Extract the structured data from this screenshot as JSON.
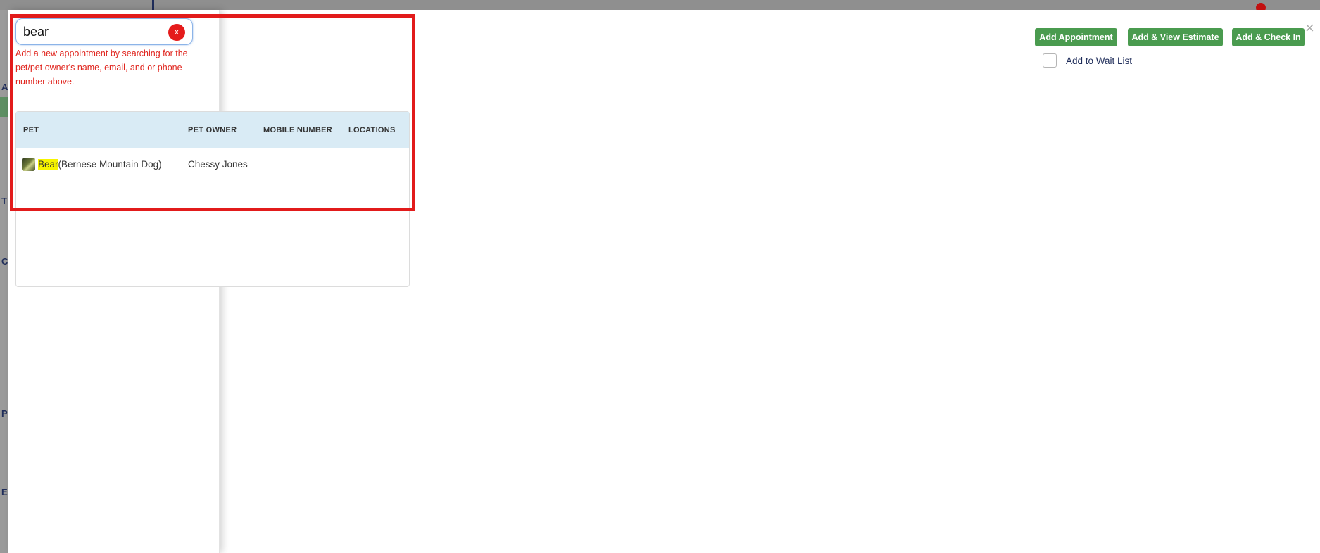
{
  "background": {
    "side_letters": [
      "A",
      "T",
      "C",
      "P",
      "E"
    ]
  },
  "search": {
    "value": "bear",
    "clear_label": "x",
    "help_text": "Add a new appointment by searching for the pet/pet owner's name, email, and or phone number above."
  },
  "results": {
    "headers": {
      "pet": "PET",
      "owner": "PET OWNER",
      "mobile": "MOBILE NUMBER",
      "locations": "LOCATIONS"
    },
    "rows": [
      {
        "pet_match": "Bear",
        "pet_breed": "(Bernese Mountain Dog)",
        "owner": "Chessy Jones",
        "mobile": "",
        "locations": ""
      }
    ]
  },
  "actions": {
    "add_appointment": "Add Appointment",
    "add_view_estimate": "Add & View Estimate",
    "add_check_in": "Add & Check In",
    "close": "×",
    "wait_list_label": "Add to Wait List"
  },
  "colors": {
    "accent_green": "#4a9b4f",
    "error_red": "#e0241d",
    "table_header": "#d9ebf5",
    "match_highlight": "#f7f500"
  }
}
